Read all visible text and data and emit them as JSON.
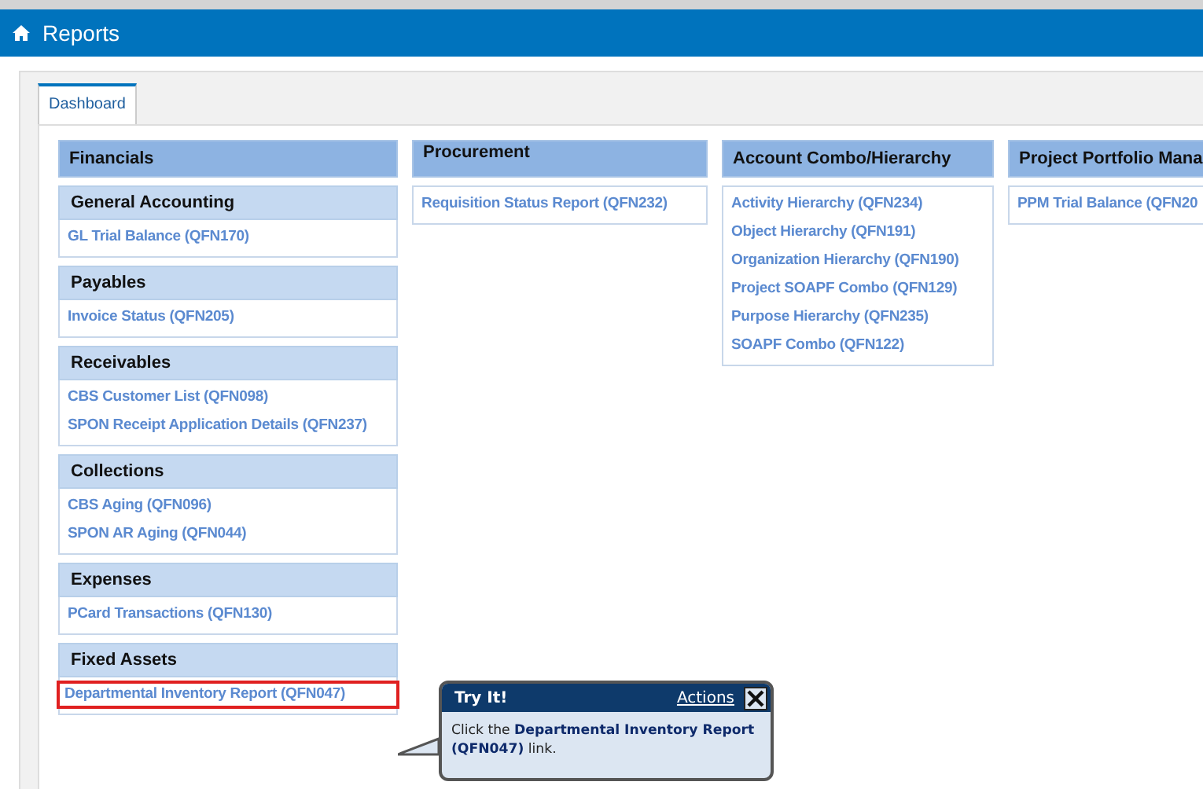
{
  "header": {
    "title": "Reports"
  },
  "tabs": [
    {
      "label": "Dashboard",
      "selected": true
    }
  ],
  "columns": [
    {
      "title": "Financials",
      "groups": [
        {
          "title": "General Accounting",
          "links": [
            {
              "label": "GL Trial Balance (QFN170)",
              "highlighted": false
            }
          ]
        },
        {
          "title": "Payables",
          "links": [
            {
              "label": "Invoice Status (QFN205)",
              "highlighted": false
            }
          ]
        },
        {
          "title": "Receivables",
          "links": [
            {
              "label": "CBS Customer List (QFN098)",
              "highlighted": false
            },
            {
              "label": "SPON Receipt Application Details (QFN237)",
              "highlighted": false
            }
          ]
        },
        {
          "title": "Collections",
          "links": [
            {
              "label": "CBS Aging (QFN096)",
              "highlighted": false
            },
            {
              "label": "SPON AR Aging (QFN044)",
              "highlighted": false
            }
          ]
        },
        {
          "title": "Expenses",
          "links": [
            {
              "label": "PCard Transactions (QFN130)",
              "highlighted": false
            }
          ]
        },
        {
          "title": "Fixed Assets",
          "links": [
            {
              "label": "Departmental Inventory Report (QFN047)",
              "highlighted": true
            }
          ]
        }
      ]
    },
    {
      "title": "Procurement",
      "groups": [
        {
          "links": [
            {
              "label": "Requisition Status Report (QFN232)",
              "highlighted": false
            }
          ]
        }
      ]
    },
    {
      "title": "Account Combo/Hierarchy",
      "groups": [
        {
          "links": [
            {
              "label": "Activity Hierarchy (QFN234)",
              "highlighted": false
            },
            {
              "label": "Object Hierarchy (QFN191)",
              "highlighted": false
            },
            {
              "label": "Organization Hierarchy (QFN190)",
              "highlighted": false
            },
            {
              "label": "Project SOAPF Combo (QFN129)",
              "highlighted": false
            },
            {
              "label": "Purpose Hierarchy (QFN235)",
              "highlighted": false
            },
            {
              "label": "SOAPF Combo (QFN122)",
              "highlighted": false
            }
          ]
        }
      ]
    },
    {
      "title": "Project Portfolio Mana",
      "groups": [
        {
          "links": [
            {
              "label": "PPM Trial Balance (QFN20",
              "highlighted": false
            }
          ]
        }
      ]
    }
  ],
  "callout": {
    "title": "Try It!",
    "actions": "Actions",
    "text": "Click the **Departmental Inventory Report (QFN047)** link."
  }
}
